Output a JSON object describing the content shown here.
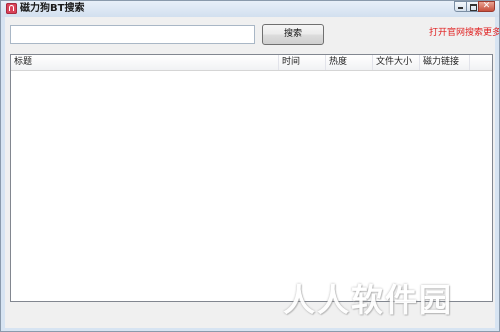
{
  "window": {
    "title": "磁力狗BT搜索",
    "icon": "magnet-app-icon"
  },
  "search": {
    "value": "",
    "placeholder": "",
    "button_label": "搜索"
  },
  "links": {
    "more": "打开官网搜索更多"
  },
  "results_table": {
    "columns": [
      "标题",
      "时间",
      "热度",
      "文件大小",
      "磁力链接"
    ],
    "rows": []
  },
  "watermark": "人人软件园",
  "colors": {
    "link": "#e02020",
    "titlebar": "#d2e0ef",
    "client_bg": "#f0f0f0"
  }
}
